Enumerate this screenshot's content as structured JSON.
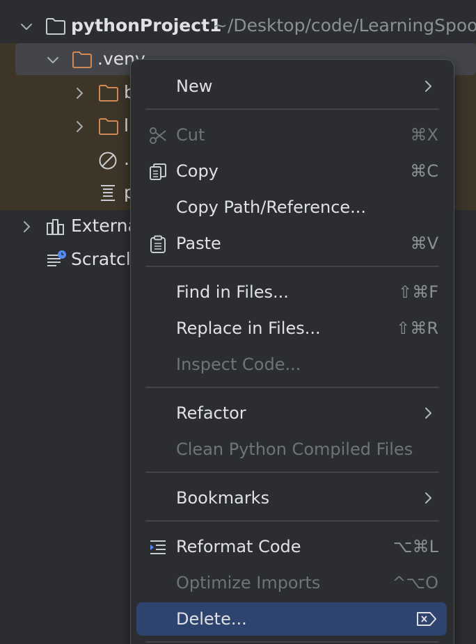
{
  "tree": {
    "root": {
      "name": "pythonProject1",
      "path": "~/Desktop/code/LearningSpoo"
    },
    "venv": {
      "name": ".venv"
    },
    "children": [
      {
        "name": "b"
      },
      {
        "name": "l"
      },
      {
        "name": "."
      },
      {
        "name": "p"
      }
    ],
    "external": {
      "name": "Externa"
    },
    "scratches": {
      "name": "Scratcl"
    }
  },
  "context_menu": {
    "items": [
      {
        "key": "new",
        "label": "New",
        "submenu": true
      },
      {
        "key": "cut",
        "label": "Cut",
        "shortcut": "⌘X",
        "disabled": true,
        "icon": "scissors-icon"
      },
      {
        "key": "copy",
        "label": "Copy",
        "shortcut": "⌘C",
        "icon": "copy-icon"
      },
      {
        "key": "copy_path",
        "label": "Copy Path/Reference..."
      },
      {
        "key": "paste",
        "label": "Paste",
        "shortcut": "⌘V",
        "icon": "clipboard-icon"
      },
      {
        "key": "find",
        "label": "Find in Files...",
        "shortcut": "⇧⌘F"
      },
      {
        "key": "replace",
        "label": "Replace in Files...",
        "shortcut": "⇧⌘R"
      },
      {
        "key": "inspect",
        "label": "Inspect Code...",
        "disabled": true
      },
      {
        "key": "refactor",
        "label": "Refactor",
        "submenu": true
      },
      {
        "key": "clean",
        "label": "Clean Python Compiled Files",
        "disabled": true
      },
      {
        "key": "bookmarks",
        "label": "Bookmarks",
        "submenu": true
      },
      {
        "key": "reformat",
        "label": "Reformat Code",
        "shortcut": "⌥⌘L",
        "icon": "reformat-icon"
      },
      {
        "key": "optimize",
        "label": "Optimize Imports",
        "shortcut": "^⌥O",
        "disabled": true
      },
      {
        "key": "delete",
        "label": "Delete...",
        "selected": true,
        "shortcut_icon": "delete-key-icon"
      }
    ]
  },
  "colors": {
    "background": "#2b2d30",
    "venv_band": "#3d3528",
    "selection": "#2e436e",
    "folder": "#d08a55",
    "text": "#dfe1e5",
    "muted": "#6f737a"
  }
}
